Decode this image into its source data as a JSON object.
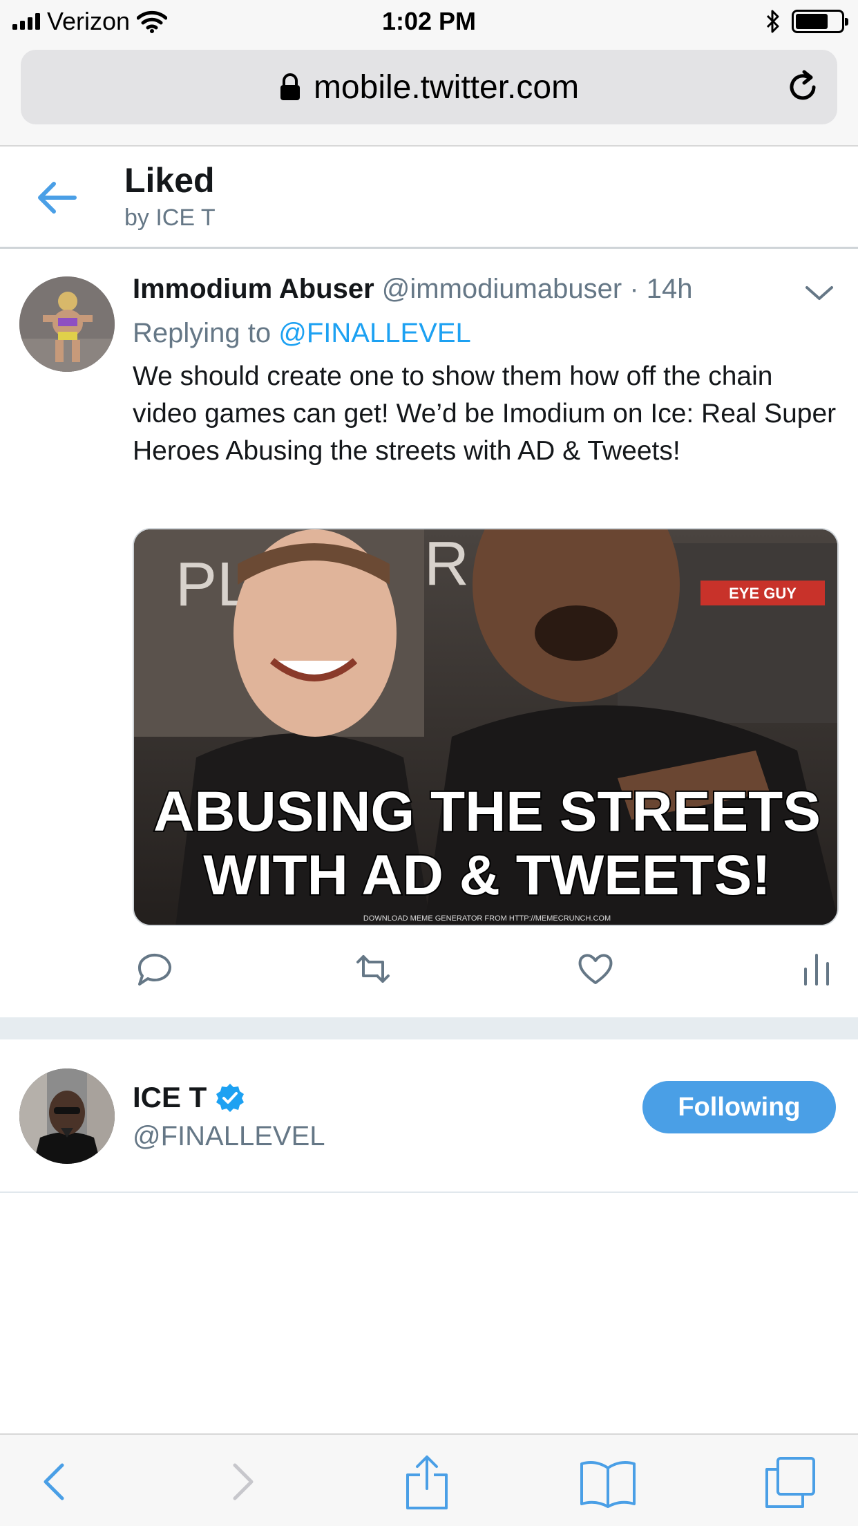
{
  "status_bar": {
    "carrier": "Verizon",
    "time": "1:02 PM"
  },
  "browser": {
    "url": "mobile.twitter.com"
  },
  "header": {
    "title": "Liked",
    "subtitle": "by ICE T"
  },
  "tweet": {
    "name": "Immodium Abuser",
    "handle": "@immodiumabuser",
    "separator": "·",
    "time": "14h",
    "reply_prefix": "Replying to",
    "reply_to": "@FINALLEVEL",
    "text": "We should create one to show them how off the chain video games can get! We’d be Imodium on Ice: Real Super Heroes Abusing the streets with AD & Tweets!",
    "media": {
      "line1": "ABUSING THE STREETS",
      "line2": "WITH AD & TWEETS!",
      "credit": "DOWNLOAD MEME GENERATOR FROM HTTP://MEMECRUNCH.COM",
      "sign_left": "PL",
      "sign_right": "R",
      "sign_shop": "EYE GUY"
    }
  },
  "user": {
    "name": "ICE T",
    "handle": "@FINALLEVEL",
    "follow_label": "Following"
  },
  "colors": {
    "accent": "#1da1f2",
    "button": "#4a9fe6",
    "secondary_text": "#657786",
    "divider": "#e6ecf0"
  }
}
